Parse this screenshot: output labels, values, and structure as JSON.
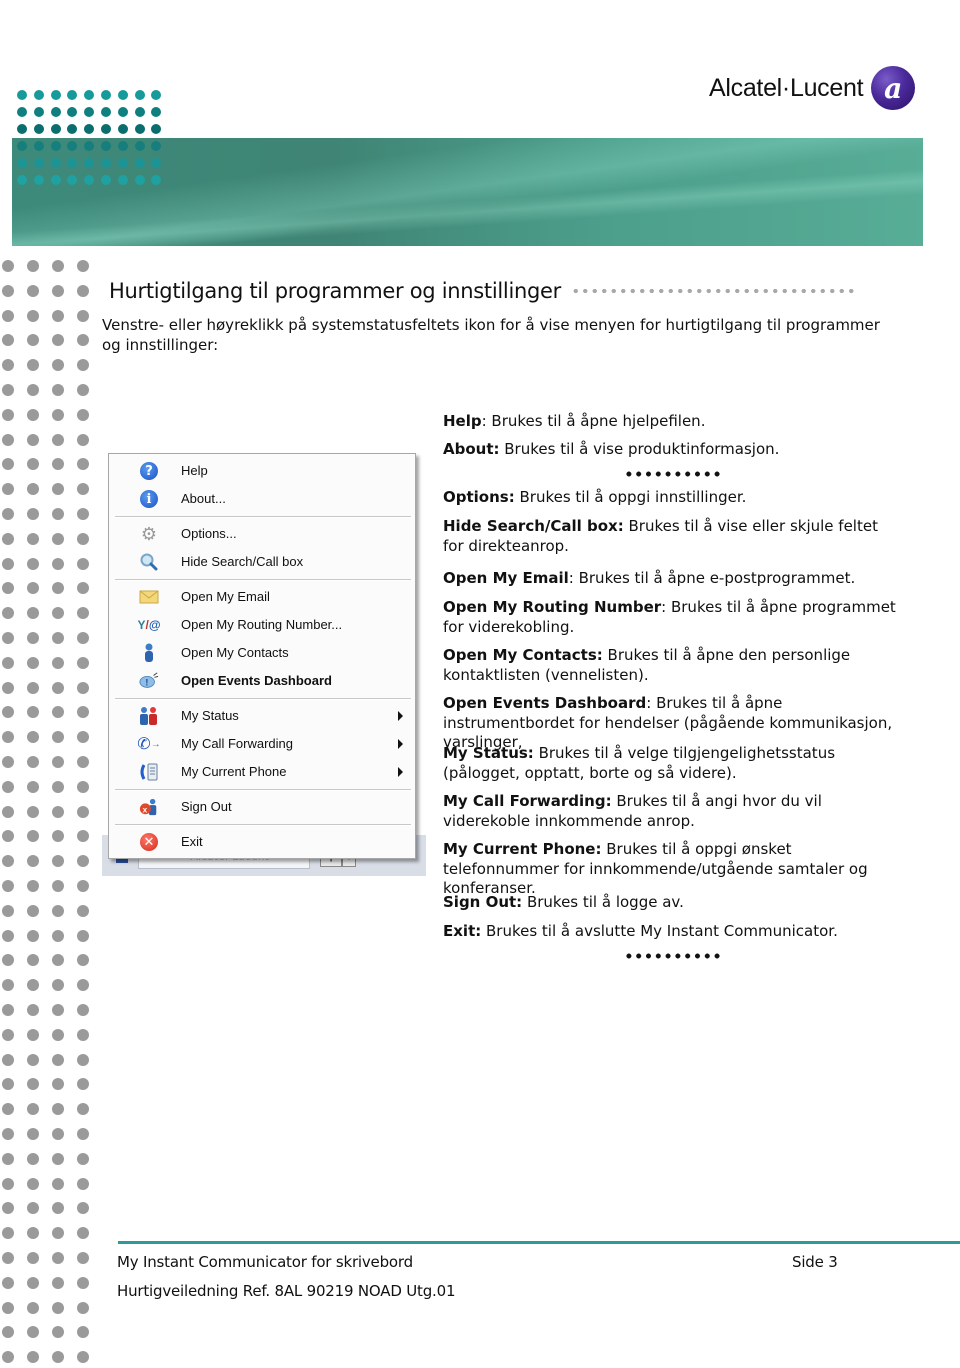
{
  "header": {
    "logo_text": "Alcatel·Lucent",
    "logo_mark": "a",
    "banner_color": "#3f8474",
    "dot_color": "#168f8f"
  },
  "title": "Hurtigtilgang til programmer og innstillinger",
  "intro": "Venstre- eller høyreklikk på systemstatusfeltets ikon for å vise menyen for hurtigtilgang til programmer og innstillinger:",
  "menu": {
    "items": [
      {
        "label": "Help",
        "icon": "help-icon"
      },
      {
        "label": "About...",
        "icon": "info-icon"
      },
      {
        "label": "Options...",
        "icon": "gear-icon"
      },
      {
        "label": "Hide Search/Call box",
        "icon": "magnifier-icon"
      },
      {
        "label": "Open My Email",
        "icon": "envelope-icon"
      },
      {
        "label": "Open My Routing Number...",
        "icon": "routing-icon"
      },
      {
        "label": "Open My Contacts",
        "icon": "contact-icon"
      },
      {
        "label": "Open Events Dashboard",
        "icon": "events-bubble-icon",
        "bold": true
      },
      {
        "label": "My Status",
        "icon": "status-people-icon",
        "submenu": true
      },
      {
        "label": "My Call Forwarding",
        "icon": "call-forward-icon",
        "submenu": true
      },
      {
        "label": "My Current Phone",
        "icon": "phone-device-icon",
        "submenu": true
      },
      {
        "label": "Sign Out",
        "icon": "sign-out-icon"
      },
      {
        "label": "Exit",
        "icon": "exit-icon"
      }
    ],
    "taskbar_text": "Alcatel-Lucent"
  },
  "descriptions": [
    {
      "term": "Help",
      "text": ": Brukes til å åpne hjelpefilen."
    },
    {
      "term": "About:",
      "text": " Brukes til å vise produktinformasjon."
    },
    {
      "term": "Options:",
      "text": " Brukes til å oppgi innstillinger."
    },
    {
      "term": "Hide Search/Call box:",
      "text": " Brukes til å vise eller skjule feltet for direkteanrop."
    },
    {
      "term": "Open My Email",
      "text": ": Brukes til å åpne e-postprogrammet."
    },
    {
      "term": "Open My Routing Number",
      "text": ": Brukes til å åpne programmet for viderekobling."
    },
    {
      "term": "Open My Contacts:",
      "text": " Brukes til å åpne den personlige kontaktlisten (vennelisten)."
    },
    {
      "term": "Open Events Dashboard",
      "text": ": Brukes til å åpne instrumentbordet for hendelser (pågående kommunikasjon, varslinger,"
    },
    {
      "term": "My Status:",
      "text": " Brukes til å velge tilgjengelighetsstatus (pålogget, opptatt, borte og så videre)."
    },
    {
      "term": "My Call Forwarding:",
      "text": " Brukes til å angi hvor du vil viderekoble innkommende anrop."
    },
    {
      "term": "My Current Phone:",
      "text": " Brukes til å oppgi ønsket telefonnummer for innkommende/utgående samtaler og konferanser."
    },
    {
      "term": "Sign Out:",
      "text": " Brukes til å logge av."
    },
    {
      "term": "Exit:",
      "text": " Brukes til å avslutte My Instant Communicator."
    }
  ],
  "footer": {
    "product": "My Instant Communicator for skrivebord",
    "reference": "Hurtigveiledning Ref. 8AL 90219 NOAD Utg.01",
    "page": "Side 3",
    "line_color": "#2a9d98"
  }
}
